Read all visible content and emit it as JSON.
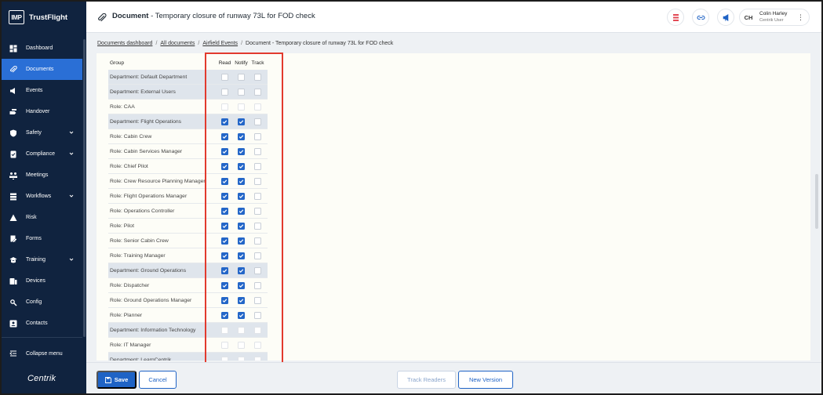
{
  "brand": {
    "logo": "IMP",
    "name": "TrustFlight"
  },
  "sidebar": {
    "items": [
      {
        "label": "Dashboard",
        "icon": "dashboard-icon",
        "active": false,
        "chevron": false
      },
      {
        "label": "Documents",
        "icon": "paperclip-icon",
        "active": true,
        "chevron": false
      },
      {
        "label": "Events",
        "icon": "megaphone-icon",
        "active": false,
        "chevron": false
      },
      {
        "label": "Handover",
        "icon": "handover-icon",
        "active": false,
        "chevron": false
      },
      {
        "label": "Safety",
        "icon": "shield-icon",
        "active": false,
        "chevron": true
      },
      {
        "label": "Compliance",
        "icon": "compliance-icon",
        "active": false,
        "chevron": true
      },
      {
        "label": "Meetings",
        "icon": "meetings-icon",
        "active": false,
        "chevron": false
      },
      {
        "label": "Workflows",
        "icon": "workflows-icon",
        "active": false,
        "chevron": true
      },
      {
        "label": "Risk",
        "icon": "risk-icon",
        "active": false,
        "chevron": false
      },
      {
        "label": "Forms",
        "icon": "forms-icon",
        "active": false,
        "chevron": false
      },
      {
        "label": "Training",
        "icon": "graduation-cap-icon",
        "active": false,
        "chevron": true
      },
      {
        "label": "Devices",
        "icon": "devices-icon",
        "active": false,
        "chevron": false
      },
      {
        "label": "Config",
        "icon": "config-icon",
        "active": false,
        "chevron": false
      },
      {
        "label": "Contacts",
        "icon": "contacts-icon",
        "active": false,
        "chevron": false
      }
    ],
    "collapse_label": "Collapse menu",
    "footer_logo": "Centrik"
  },
  "header": {
    "title_prefix": "Document",
    "title_sep": " - ",
    "title": "Temporary closure of runway 73L for FOD check",
    "user": {
      "initials": "CH",
      "name": "Colin Harley",
      "role": "Centrik User"
    }
  },
  "breadcrumb": {
    "links": [
      "Documents dashboard",
      "All documents",
      "Airfield Events"
    ],
    "current": "Document - Temporary closure of runway 73L for FOD check",
    "separator": "/"
  },
  "permissions": {
    "headers": {
      "group": "Group",
      "read": "Read",
      "notify": "Notify",
      "track": "Track"
    },
    "rows": [
      {
        "group": "Department: Default Department",
        "type": "dept",
        "read": false,
        "notify": false,
        "track": false
      },
      {
        "group": "Department: External Users",
        "type": "dept",
        "read": false,
        "notify": false,
        "track": false
      },
      {
        "group": "Role: CAA",
        "type": "role",
        "read": false,
        "notify": false,
        "track": false
      },
      {
        "group": "Department: Flight Operations",
        "type": "dept",
        "read": true,
        "notify": true,
        "track": false
      },
      {
        "group": "Role: Cabin Crew",
        "type": "role",
        "read": true,
        "notify": true,
        "track": false
      },
      {
        "group": "Role: Cabin Services Manager",
        "type": "role",
        "read": true,
        "notify": true,
        "track": false
      },
      {
        "group": "Role: Chief Pilot",
        "type": "role",
        "read": true,
        "notify": true,
        "track": false
      },
      {
        "group": "Role: Crew Resource Planning Manager",
        "type": "role",
        "read": true,
        "notify": true,
        "track": false
      },
      {
        "group": "Role: Flight Operations Manager",
        "type": "role",
        "read": true,
        "notify": true,
        "track": false
      },
      {
        "group": "Role: Operations Controller",
        "type": "role",
        "read": true,
        "notify": true,
        "track": false
      },
      {
        "group": "Role: Pilot",
        "type": "role",
        "read": true,
        "notify": true,
        "track": false
      },
      {
        "group": "Role: Senior Cabin Crew",
        "type": "role",
        "read": true,
        "notify": true,
        "track": false
      },
      {
        "group": "Role: Training Manager",
        "type": "role",
        "read": true,
        "notify": true,
        "track": false
      },
      {
        "group": "Department: Ground Operations",
        "type": "dept",
        "read": true,
        "notify": true,
        "track": false
      },
      {
        "group": "Role: Dispatcher",
        "type": "role",
        "read": true,
        "notify": true,
        "track": false
      },
      {
        "group": "Role: Ground Operations Manager",
        "type": "role",
        "read": true,
        "notify": true,
        "track": false
      },
      {
        "group": "Role: Planner",
        "type": "role",
        "read": true,
        "notify": true,
        "track": false
      },
      {
        "group": "Department: Information Technology",
        "type": "dept",
        "read": false,
        "notify": false,
        "track": false
      },
      {
        "group": "Role: IT Manager",
        "type": "role",
        "read": false,
        "notify": false,
        "track": false
      },
      {
        "group": "Department: LearnCentrik",
        "type": "dept",
        "read": false,
        "notify": false,
        "track": false
      }
    ]
  },
  "footer": {
    "save_label": "Save",
    "cancel_label": "Cancel",
    "track_readers_label": "Track Readers",
    "new_version_label": "New Version"
  },
  "colors": {
    "sidebar_bg": "#10233f",
    "active_nav": "#2a6fd6",
    "primary": "#1f63c5",
    "highlight_border": "#e23a2e"
  }
}
